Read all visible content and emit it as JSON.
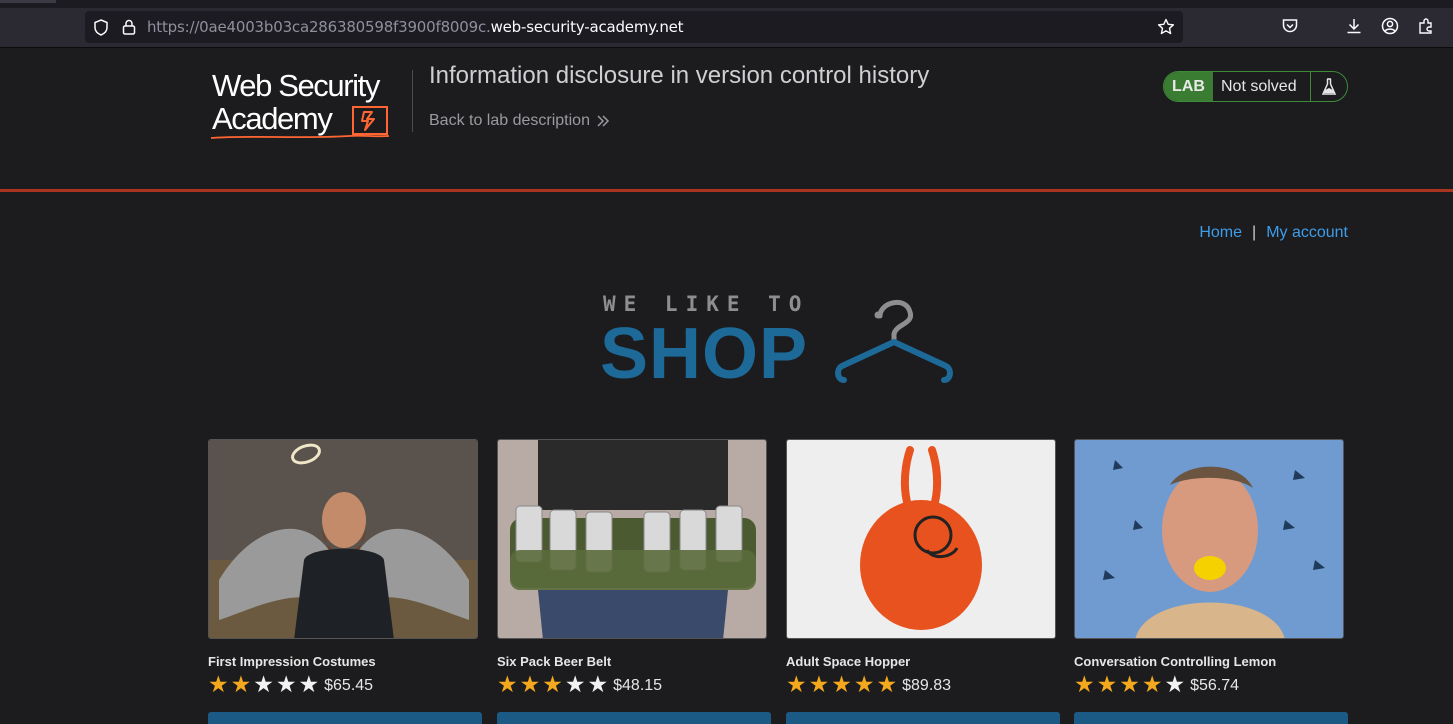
{
  "browser": {
    "url_prefix": "https://0ae4003b03ca286380598f3900f8009c.",
    "url_domain": "web-security-academy.net",
    "icons": [
      "shield-icon",
      "lock-icon",
      "bookmark-star-icon",
      "pocket-icon",
      "download-icon",
      "account-icon",
      "extensions-icon"
    ]
  },
  "lab": {
    "logo_line1": "Web Security",
    "logo_line2": "Academy",
    "title": "Information disclosure in version control history",
    "back_link": "Back to lab description",
    "badge": "LAB",
    "status": "Not solved",
    "status_icon": "flask-icon",
    "accent_color": "#a8341f"
  },
  "nav": {
    "home": "Home",
    "separator": "|",
    "account": "My account"
  },
  "shop_logo": {
    "tagline": "WE LIKE TO",
    "word": "SHOP",
    "color": "#1d6a99"
  },
  "products": [
    {
      "name": "First Impression Costumes",
      "rating": 2,
      "price": "$65.45"
    },
    {
      "name": "Six Pack Beer Belt",
      "rating": 3,
      "price": "$48.15"
    },
    {
      "name": "Adult Space Hopper",
      "rating": 5,
      "price": "$89.83"
    },
    {
      "name": "Conversation Controlling Lemon",
      "rating": 4,
      "price": "$56.74"
    }
  ]
}
